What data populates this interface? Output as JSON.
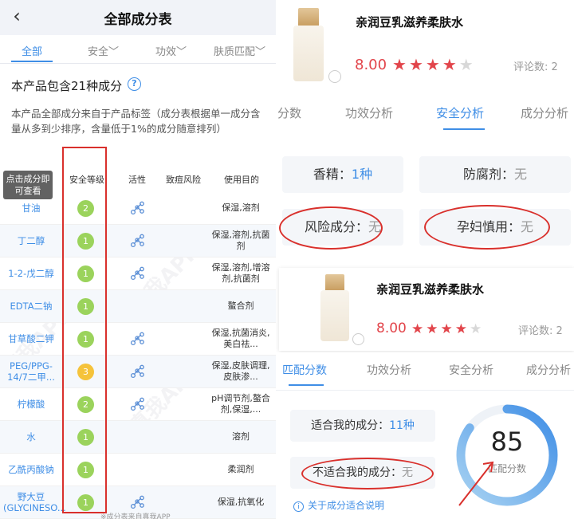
{
  "left": {
    "back_glyph": "‹",
    "title": "全部成分表",
    "tabs": [
      {
        "label": "全部",
        "active": true
      },
      {
        "label": "安全﹀",
        "active": false
      },
      {
        "label": "功效﹀",
        "active": false
      },
      {
        "label": "肤质匹配﹀",
        "active": false
      }
    ],
    "count_text": "本产品包含21种成分",
    "help_glyph": "?",
    "note": "本产品全部成分来自于产品标签（成分表根据单一成分含量从多到少排序，含量低于1%的成分随意排列）",
    "table_headers": [
      "安全等级",
      "活性",
      "致痘风险",
      "使用目的"
    ],
    "tip_badge": "点击成分即可查看",
    "rows": [
      {
        "name": "甘油",
        "level": "2",
        "level_color": "#9bd35c",
        "active": true,
        "use": "保湿,溶剂"
      },
      {
        "name": "丁二醇",
        "level": "1",
        "level_color": "#9bd35c",
        "active": true,
        "use": "保湿,溶剂,抗菌剂"
      },
      {
        "name": "1-2-戊二醇",
        "level": "1",
        "level_color": "#9bd35c",
        "active": true,
        "use": "保湿,溶剂,增溶剂,抗菌剂"
      },
      {
        "name": "EDTA二钠",
        "level": "1",
        "level_color": "#9bd35c",
        "active": false,
        "use": "螯合剂"
      },
      {
        "name": "甘草酸二钾",
        "level": "1",
        "level_color": "#9bd35c",
        "active": true,
        "use": "保湿,抗菌消炎,美白祛..."
      },
      {
        "name": "PEG/PPG-14/7二甲...",
        "level": "3",
        "level_color": "#f5c33b",
        "active": true,
        "use": "保湿,皮肤调理,皮肤渗..."
      },
      {
        "name": "柠檬酸",
        "level": "2",
        "level_color": "#9bd35c",
        "active": true,
        "use": "pH调节剂,螯合剂,保湿,..."
      },
      {
        "name": "水",
        "level": "1",
        "level_color": "#9bd35c",
        "active": false,
        "use": "溶剂"
      },
      {
        "name": "乙酰丙酸钠",
        "level": "1",
        "level_color": "#9bd35c",
        "active": false,
        "use": "柔润剂"
      },
      {
        "name": "野大豆(GLYCINESO...",
        "level": "1",
        "level_color": "#9bd35c",
        "active": true,
        "use": "保湿,抗氧化"
      }
    ],
    "footnote": "※成分表来自真我APP",
    "watermark": "真我APP"
  },
  "right_top": {
    "product_name": "亲润豆乳滋养柔肤水",
    "score": "8.00",
    "stars": {
      "filled": 4,
      "total": 5
    },
    "comment_count": "评论数: 2",
    "segments": [
      {
        "label": "分数",
        "active": false
      },
      {
        "label": "功效分析",
        "active": false
      },
      {
        "label": "安全分析",
        "active": true
      },
      {
        "label": "成分分析",
        "active": false
      }
    ],
    "cards": {
      "fragrance_label": "香精：",
      "fragrance_value": "1种",
      "preservative_label": "防腐剂：",
      "preservative_value": "无",
      "risk_label": "风险成分：",
      "risk_value": "无",
      "pregnancy_label": "孕妇慎用：",
      "pregnancy_value": "无"
    }
  },
  "right_bottom": {
    "product_name": "亲润豆乳滋养柔肤水",
    "score": "8.00",
    "stars": {
      "filled": 4,
      "total": 5
    },
    "comment_count": "评论数: 2",
    "segments": [
      {
        "label": "匹配分数",
        "active": true
      },
      {
        "label": "功效分析",
        "active": false
      },
      {
        "label": "安全分析",
        "active": false
      },
      {
        "label": "成分分析",
        "active": false
      }
    ],
    "suitable_label": "适合我的成分：",
    "suitable_value": "11种",
    "unsuitable_label": "不适合我的成分：",
    "unsuitable_value": "无",
    "explain_link": "关于成分适合说明",
    "match_score": "85",
    "match_score_label": "匹配分数",
    "match_score_fraction": 0.85
  },
  "colors": {
    "accent": "#3f8ee6",
    "rating": "#e2454b",
    "highlight_red": "#d9302c",
    "safe_green": "#9bd35c",
    "warn_yellow": "#f5c33b"
  }
}
